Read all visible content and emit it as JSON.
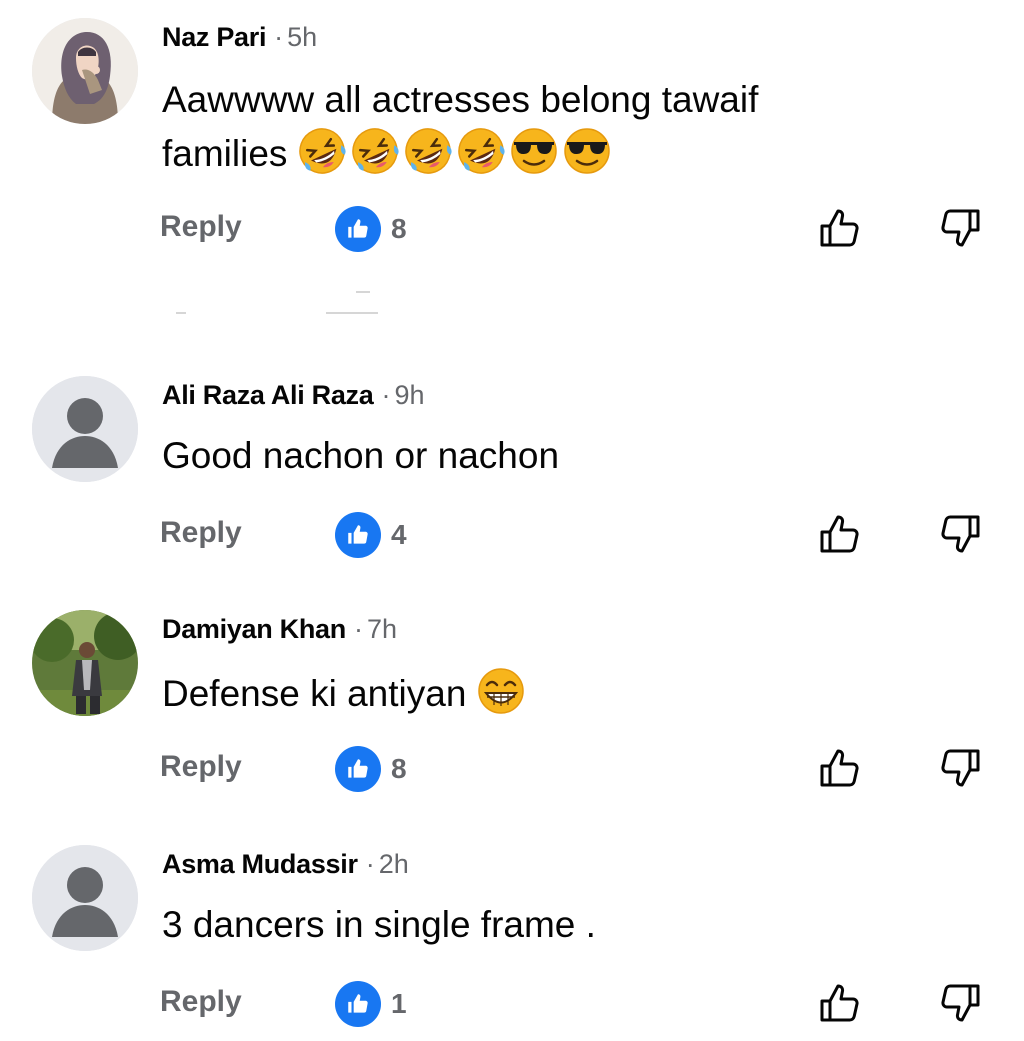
{
  "comments": [
    {
      "author": "Naz Pari",
      "time": "5h",
      "text_line1": "Aawwww all actresses  belong tawaif",
      "text_line2": "families",
      "emojis": [
        "rolling-on-floor-laughing-emoji",
        "rolling-on-floor-laughing-emoji",
        "rolling-on-floor-laughing-emoji",
        "rolling-on-floor-laughing-emoji",
        "smiling-face-with-sunglasses-emoji",
        "smiling-face-with-sunglasses-emoji"
      ],
      "reply_label": "Reply",
      "like_count": "8",
      "avatar": "hijab-woman-avatar"
    },
    {
      "author": "Ali Raza Ali Raza",
      "time": "9h",
      "text": "Good nachon or nachon",
      "reply_label": "Reply",
      "like_count": "4",
      "avatar": "default-avatar"
    },
    {
      "author": "Damiyan Khan",
      "time": "7h",
      "text": "Defense ki antiyan",
      "emojis": [
        "grinning-face-emoji"
      ],
      "reply_label": "Reply",
      "like_count": "8",
      "avatar": "man-outdoors-avatar"
    },
    {
      "author": "Asma Mudassir",
      "time": "2h",
      "text": "3 dancers in single frame .",
      "reply_label": "Reply",
      "like_count": "1",
      "avatar": "default-avatar"
    }
  ],
  "colors": {
    "accent": "#1877f2",
    "secondary_text": "#65676b",
    "primary_text": "#050505",
    "avatar_bg": "#e4e6eb",
    "avatar_fg": "#bcc0c4"
  }
}
